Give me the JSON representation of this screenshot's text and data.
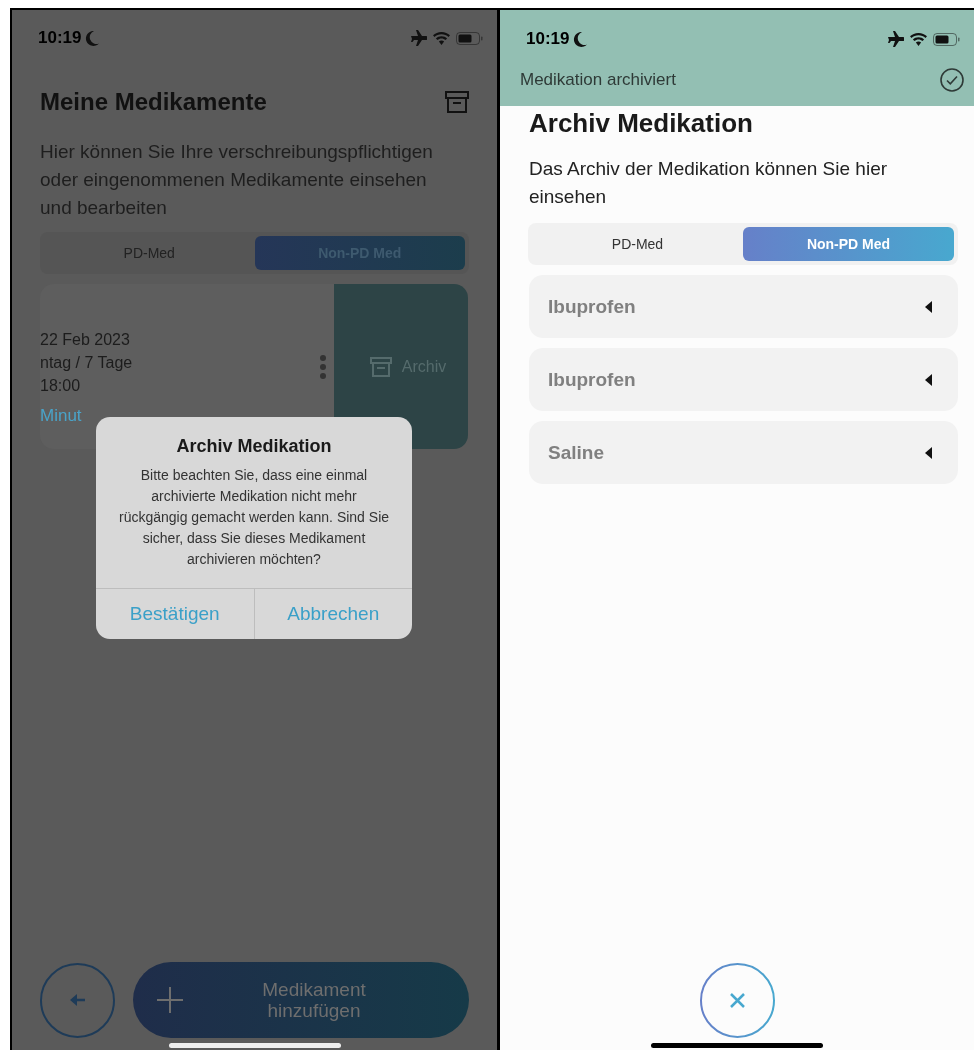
{
  "left_screen": {
    "status_bar": {
      "time": "10:19"
    },
    "header": {
      "title": "Meine Medikamente"
    },
    "description": "Hier können Sie Ihre verschreibungspflichtigen oder eingenommenen Medikamente einsehen und bearbeiten",
    "segments": [
      {
        "label": "PD-Med",
        "selected": false
      },
      {
        "label": "Non-PD Med",
        "selected": true
      }
    ],
    "medication_card": {
      "lines": [
        "22 Feb 2023",
        "ntag / 7 Tage",
        "18:00"
      ],
      "reminder": "Minut",
      "swipe_action": "Archiv"
    },
    "dialog": {
      "title": "Archiv Medikation",
      "message": "Bitte beachten Sie, dass eine einmal archivierte Medikation nicht mehr rückgängig gemacht werden kann. Sind Sie sicher, dass Sie dieses Medikament archivieren möchten?",
      "buttons": [
        "Bestätigen",
        "Abbrechen"
      ]
    },
    "add_button": "Medikament hinzufügen"
  },
  "right_screen": {
    "status_bar": {
      "time": "10:19"
    },
    "toast": {
      "message": "Medikation archiviert"
    },
    "title": "Archiv Medikation",
    "description": "Das Archiv der Medikation können Sie hier einsehen",
    "segments": [
      {
        "label": "PD-Med",
        "selected": false
      },
      {
        "label": "Non-PD Med",
        "selected": true
      }
    ],
    "medications": [
      {
        "name": "Ibuprofen"
      },
      {
        "name": "Ibuprofen"
      },
      {
        "name": "Saline"
      }
    ]
  }
}
